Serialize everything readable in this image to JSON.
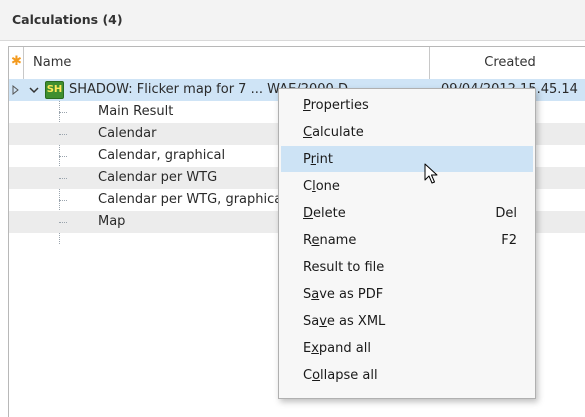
{
  "panel": {
    "title": "Calculations (4)"
  },
  "grid": {
    "columns": {
      "star": "✱",
      "name": "Name",
      "created": "Created"
    },
    "root": {
      "label": "SHADOW: Flicker map for 7 ... WAE/2000 D...",
      "date": "09/04/2012 15.45.14",
      "icon_text": "SH"
    },
    "children": [
      {
        "label": "Main Result"
      },
      {
        "label": "Calendar"
      },
      {
        "label": "Calendar, graphical"
      },
      {
        "label": "Calendar per WTG"
      },
      {
        "label": "Calendar per WTG, graphical"
      },
      {
        "label": "Map"
      }
    ]
  },
  "context_menu": {
    "items": [
      {
        "pre": "",
        "ul": "P",
        "post": "roperties",
        "key": ""
      },
      {
        "pre": "",
        "ul": "C",
        "post": "alculate",
        "key": ""
      },
      {
        "pre": "P",
        "ul": "r",
        "post": "int",
        "key": ""
      },
      {
        "pre": "C",
        "ul": "l",
        "post": "one",
        "key": ""
      },
      {
        "pre": "",
        "ul": "D",
        "post": "elete",
        "key": "Del"
      },
      {
        "pre": "R",
        "ul": "e",
        "post": "name",
        "key": "F2"
      },
      {
        "pre": "Result to file",
        "ul": "",
        "post": "",
        "key": ""
      },
      {
        "pre": "S",
        "ul": "a",
        "post": "ve as PDF",
        "key": ""
      },
      {
        "pre": "Sa",
        "ul": "v",
        "post": "e as XML",
        "key": ""
      },
      {
        "pre": "E",
        "ul": "x",
        "post": "pand all",
        "key": ""
      },
      {
        "pre": "C",
        "ul": "o",
        "post": "llapse all",
        "key": ""
      }
    ],
    "highlighted": "Print"
  },
  "colors": {
    "selection": "#cfe4f6",
    "menu_highlight": "#cde3f5",
    "alt_row": "#ececec",
    "star": "#f39a1e",
    "shadow_icon": "#3f8f2f"
  }
}
